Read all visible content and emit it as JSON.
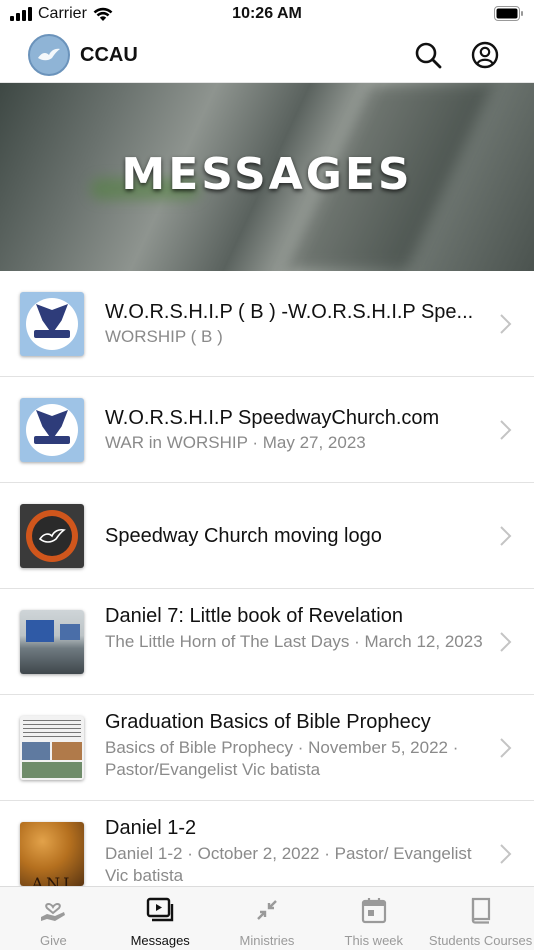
{
  "status_bar": {
    "carrier": "Carrier",
    "time": "10:26 AM"
  },
  "header": {
    "title": "CCAU",
    "icons": [
      "search-icon",
      "account-icon"
    ]
  },
  "hero": {
    "title": "MESSAGES"
  },
  "messages": [
    {
      "title": "W.O.R.S.H.I.P ( B ) -W.O.R.S.H.I.P Spe...",
      "subtitle": "WORSHIP ( B )",
      "thumb": "worship-logo"
    },
    {
      "title": "W.O.R.S.H.I.P SpeedwayChurch.com",
      "subtitle": "WAR in WORSHIP · May 27, 2023",
      "thumb": "worship-logo"
    },
    {
      "title": "Speedway Church moving logo",
      "subtitle": "",
      "thumb": "church-logo"
    },
    {
      "title": "Daniel 7: Little book of Revelation",
      "subtitle": "The Little Horn of The Last Days · March 12, 2023",
      "thumb": "sanctuary-photo"
    },
    {
      "title": "Graduation Basics of Bible Prophecy",
      "subtitle": "Basics of Bible Prophecy · November 5, 2022 · Pastor/Evangelist Vic batista",
      "thumb": "graduation-collage"
    },
    {
      "title": "Daniel 1-2",
      "subtitle": "Daniel 1-2 · October 2, 2022 · Pastor/ Evangelist Vic batista",
      "thumb": "book-of-daniel",
      "thumb_text": "ANI"
    }
  ],
  "tabs": [
    {
      "label": "Give",
      "icon": "give-icon",
      "active": false
    },
    {
      "label": "Messages",
      "icon": "messages-icon",
      "active": true
    },
    {
      "label": "Ministries",
      "icon": "ministries-icon",
      "active": false
    },
    {
      "label": "This week",
      "icon": "calendar-icon",
      "active": false
    },
    {
      "label": "Students Courses",
      "icon": "book-icon",
      "active": false
    }
  ],
  "colors": {
    "active_tab": "#111111",
    "inactive_tab": "#9a9a9a",
    "subtitle": "#8a8a8a",
    "logo_blue": "#8fb4d6"
  }
}
